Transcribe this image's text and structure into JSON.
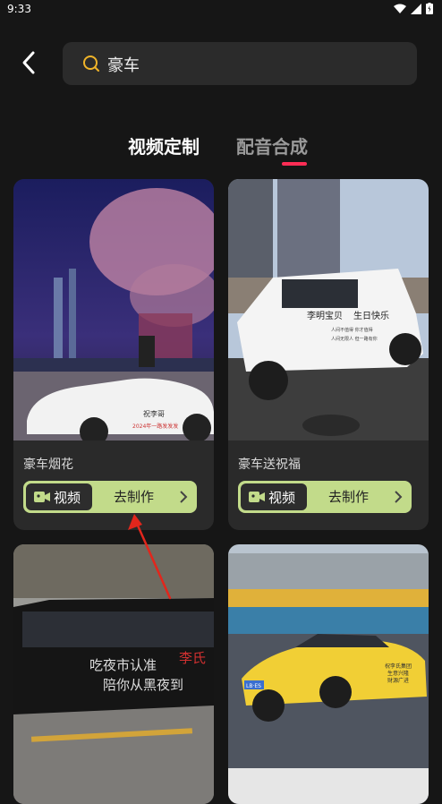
{
  "status": {
    "time": "9:33"
  },
  "search": {
    "query": "豪车"
  },
  "tabs": [
    {
      "label": "视频定制",
      "active": true
    },
    {
      "label": "配音合成",
      "active": false
    }
  ],
  "cards": [
    {
      "title": "豪车烟花",
      "type_label": "视频",
      "action_label": "去制作",
      "thumb_text": [
        "祝李哥",
        "2024年一路发发发"
      ]
    },
    {
      "title": "豪车送祝福",
      "type_label": "视频",
      "action_label": "去制作",
      "thumb_text": [
        "李明宝贝",
        "生日快乐",
        "人间不值得 你才值得",
        "人间无限人 但一路有你"
      ]
    },
    {
      "title": "",
      "type_label": "",
      "action_label": "",
      "thumb_text": [
        "吃夜市认准",
        "李氏",
        "陪你从黑夜到"
      ]
    },
    {
      "title": "",
      "type_label": "",
      "action_label": "",
      "thumb_text": [
        "祝李氏集团",
        "生意兴隆",
        "财源广进",
        "LB·ES"
      ]
    }
  ],
  "colors": {
    "accent": "#ff2d55",
    "pill": "#c2db8a",
    "arrow": "#e2261c"
  }
}
